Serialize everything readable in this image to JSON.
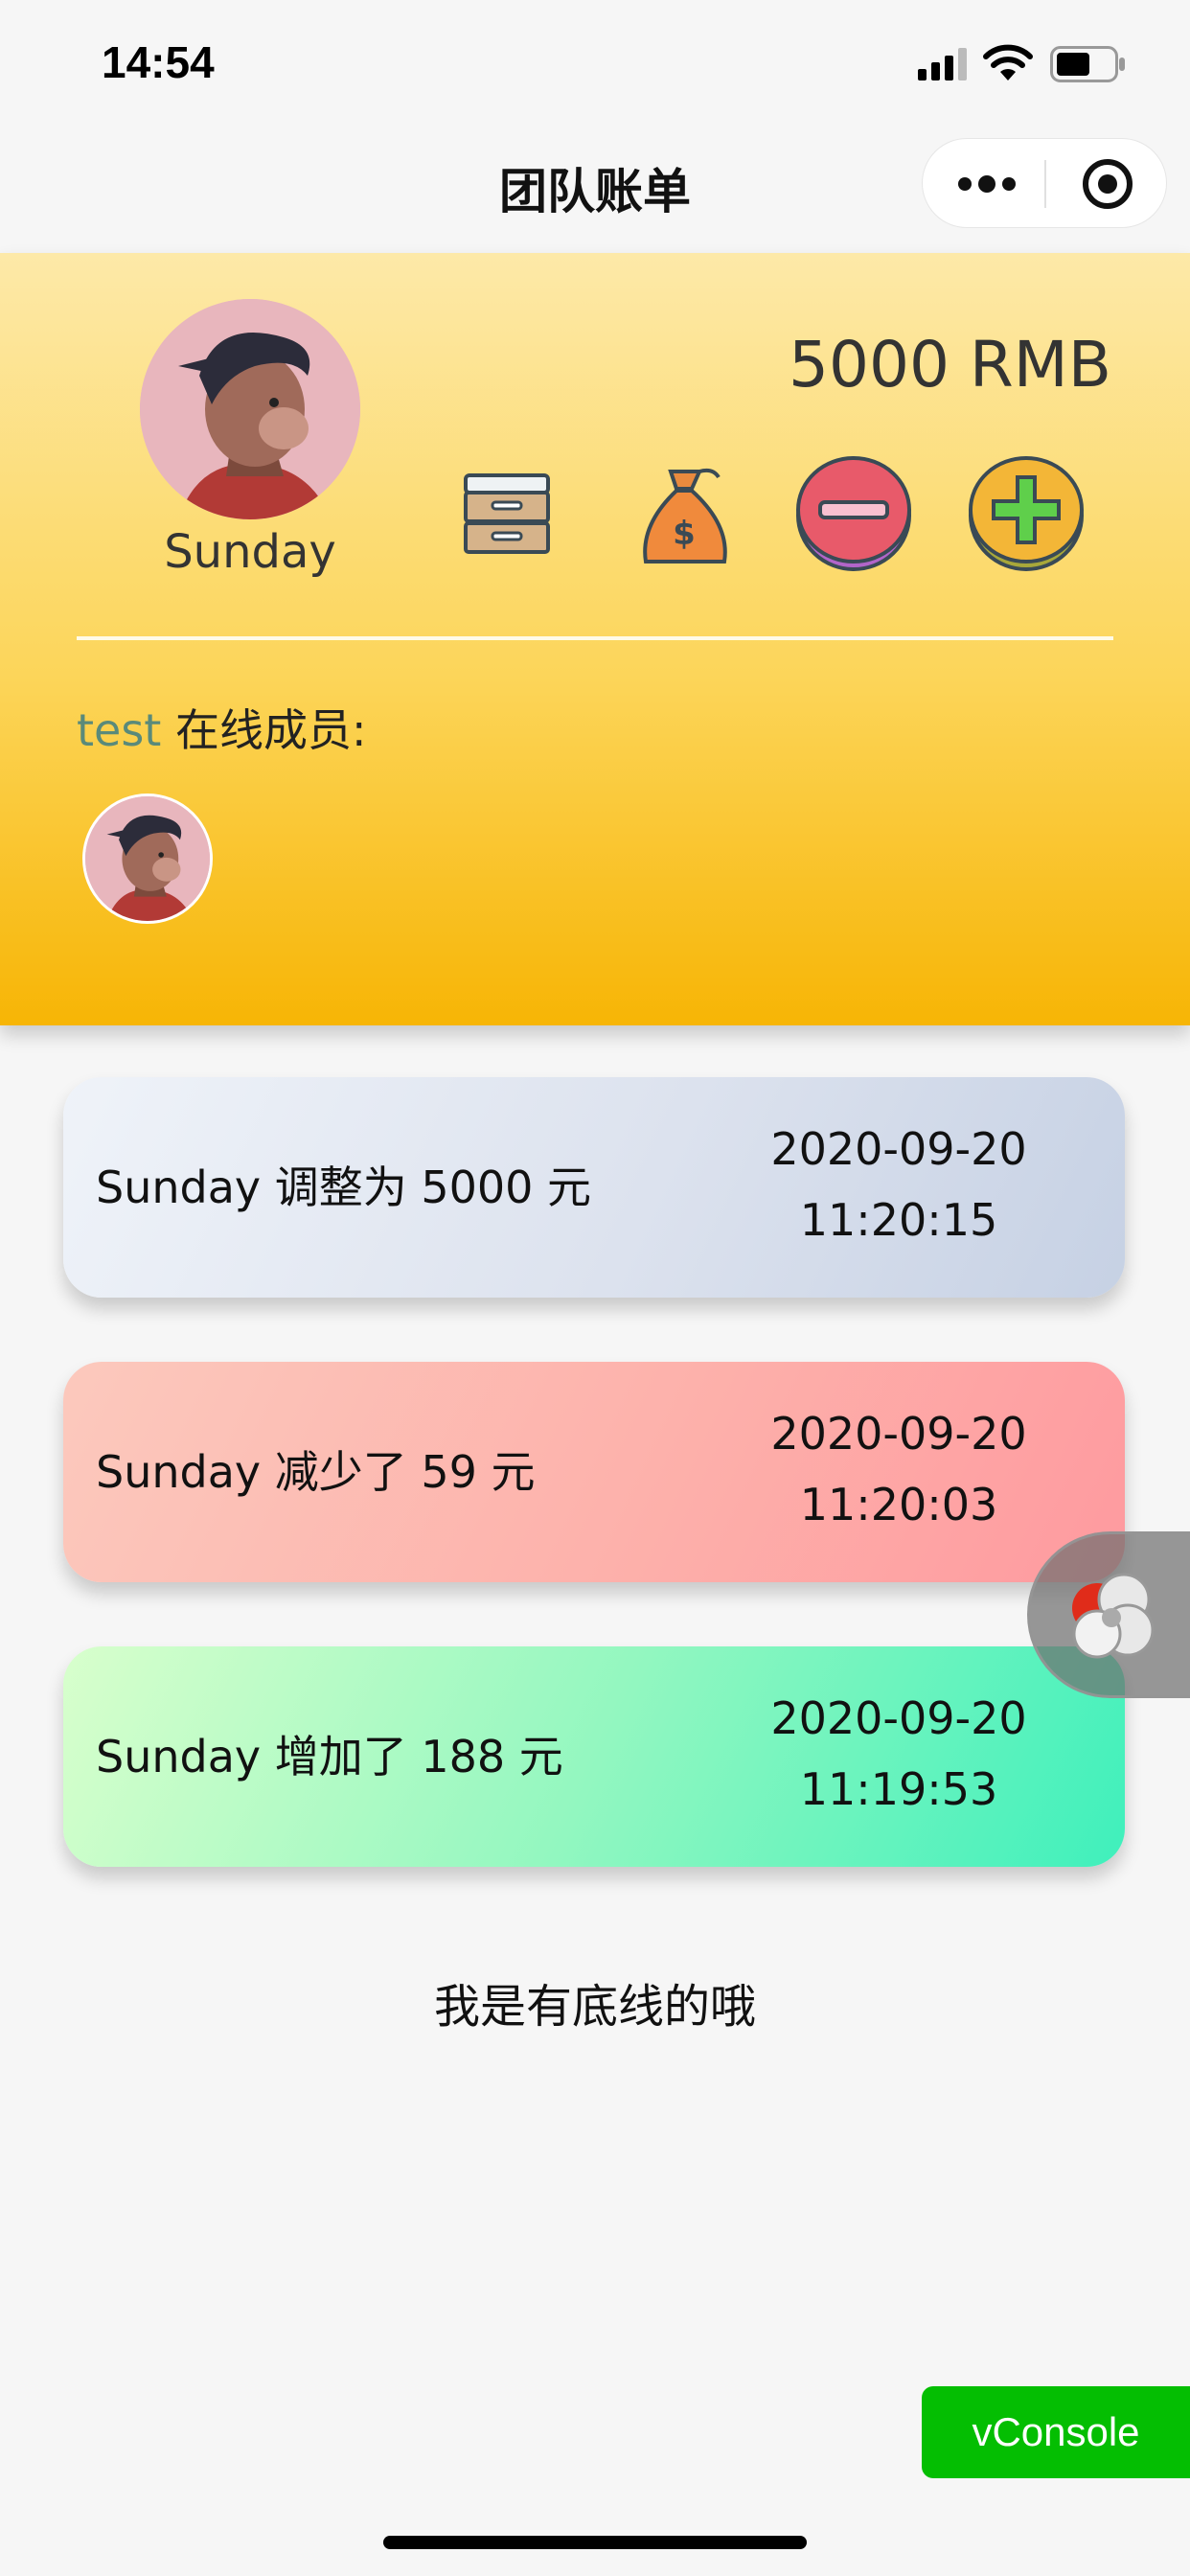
{
  "status_bar": {
    "time": "14:54"
  },
  "nav": {
    "title": "团队账单"
  },
  "header": {
    "user_name": "Sunday",
    "balance": "5000 RMB",
    "team_name": "test",
    "online_members_label": " 在线成员:"
  },
  "records": [
    {
      "desc": "Sunday 调整为 5000 元",
      "date": "2020-09-20",
      "time": "11:20:15"
    },
    {
      "desc": "Sunday 减少了 59 元",
      "date": "2020-09-20",
      "time": "11:20:03"
    },
    {
      "desc": "Sunday 增加了 188 元",
      "date": "2020-09-20",
      "time": "11:19:53"
    }
  ],
  "footer": {
    "text": "我是有底线的哦"
  },
  "vconsole": {
    "label": "vConsole"
  },
  "colors": {
    "header_top": "#fde9a8",
    "header_bottom": "#f7b505",
    "vconsole_green": "#04be02"
  }
}
